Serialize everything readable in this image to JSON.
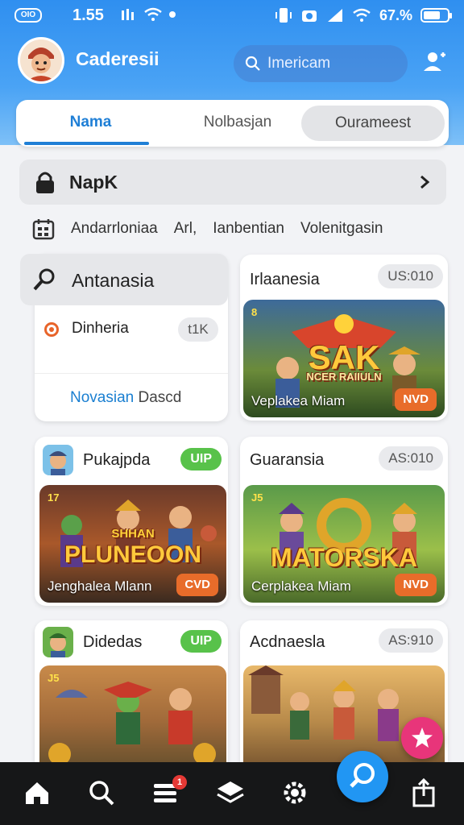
{
  "status_bar": {
    "left_pill": "OIO",
    "time": "1.55",
    "battery_pct": "67.%",
    "battery_level": 0.67
  },
  "header": {
    "app_title": "Caderesii",
    "search_placeholder": "Imericam"
  },
  "tabs": [
    {
      "label": "Nama",
      "active": true
    },
    {
      "label": "Nolbasjan"
    },
    {
      "label": "Ourameest"
    }
  ],
  "napk": {
    "label": "NapK"
  },
  "filters": [
    "Andarrloniaa",
    "Arl,",
    "Ianbentian",
    "Volenitgasin"
  ],
  "menu": {
    "head": "Antanasia",
    "item": {
      "label": "Dinheria",
      "badge": "t1K"
    },
    "foot_a": "Novasian",
    "foot_b": "Dascd"
  },
  "cards": {
    "c1": {
      "title": "Irlaanesia",
      "badge": "US:010",
      "art_title": "SAK",
      "art_sub": "NCER RAIIULN",
      "caption": "Veplakea Miam",
      "art_badge": "NVD",
      "tag": "8"
    },
    "c2": {
      "title": "Pukajpda",
      "badge": "UIP",
      "art_title_1": "SHHAN",
      "art_title_2": "PLUNEOON",
      "caption": "Jenghalea Mlann",
      "art_badge": "CVD",
      "tag": "17"
    },
    "c3": {
      "title": "Guaransia",
      "badge": "AS:010",
      "art_title": "MATORSKA",
      "caption": "Cerplakea Miam",
      "art_badge": "NVD",
      "tag": "J5"
    },
    "c4": {
      "title": "Didedas",
      "badge": "UIP",
      "tag": "J5"
    },
    "c5": {
      "title": "Acdnaesla",
      "badge": "AS:910"
    }
  },
  "colors": {
    "header_blue": "#2f8ff0",
    "accent": "#1f7fd6",
    "green_badge": "#58c24a",
    "orange_badge": "#e86c2a",
    "fab_blue": "#2196f3",
    "fab_pink": "#e8357a"
  },
  "nav": {
    "items": [
      "home-icon",
      "search-icon",
      "list-icon",
      "layers-icon",
      "settings-icon",
      "share-icon"
    ],
    "notif_count": "1"
  }
}
